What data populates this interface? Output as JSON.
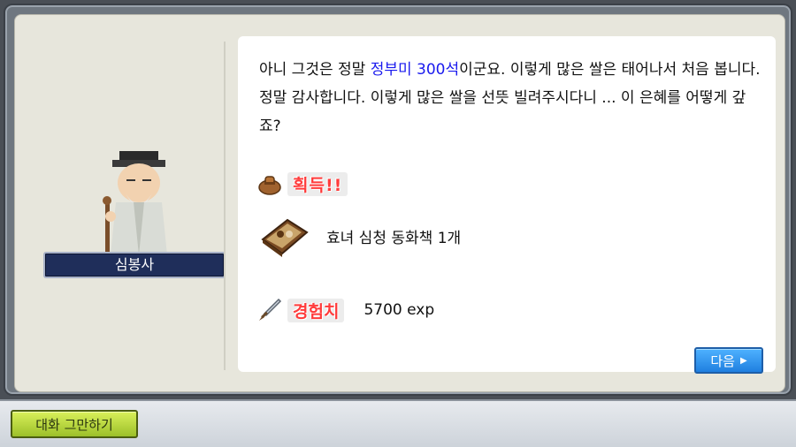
{
  "npc": {
    "name": "심봉사"
  },
  "dialog": {
    "text_before": "아니 그것은 정말 ",
    "highlight": "정부미 300석",
    "text_after": "이군요. 이렇게 많은 쌀은 태어나서 처음 봅니다. 정말 감사합니다. 이렇게 많은 쌀을 선뜻 빌려주시다니 ... 이 은혜를 어떻게 갚죠?"
  },
  "reward": {
    "title": "획득!!",
    "item_name": "효녀 심청 동화책 1개",
    "exp_title": "경험치",
    "exp_value": "5700 exp"
  },
  "buttons": {
    "next_label": "다음",
    "end_chat_label": "대화 그만하기"
  },
  "colors": {
    "highlight": "#1a1aee",
    "reward_title": "#ff3b3b",
    "nameplate_bg": "#1f2e5a",
    "next_button": "#1f7fe0",
    "end_chat_button": "#9cc02a"
  }
}
